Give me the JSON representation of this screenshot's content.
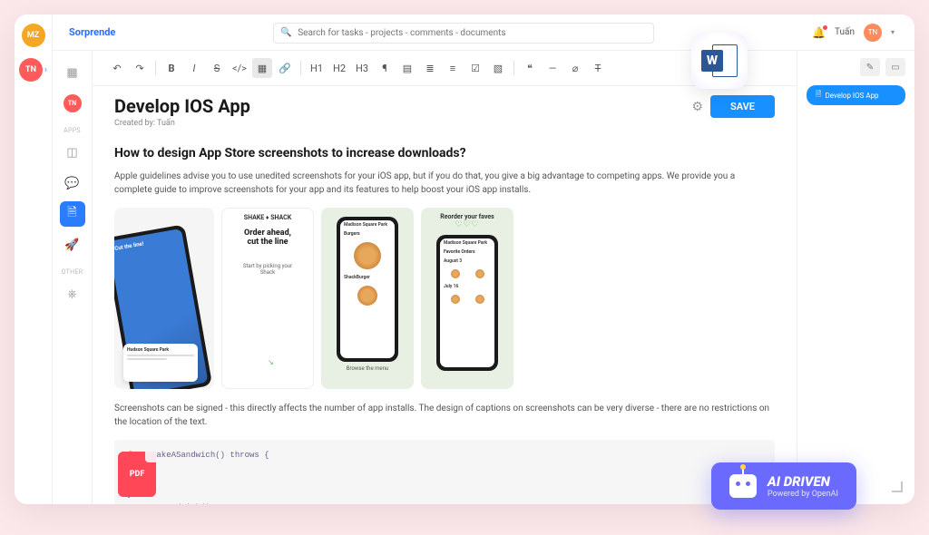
{
  "brand": "Sorprende",
  "search": {
    "placeholder": "Search for tasks - projects - comments - documents"
  },
  "user": {
    "name": "Tuấn",
    "initials": "TN"
  },
  "avatars": {
    "top": "MZ",
    "bottom": "TN"
  },
  "nav": {
    "group1": "APPS",
    "group2": "OTHER"
  },
  "toolbar": {
    "h1": "H1",
    "h2": "H2",
    "h3": "H3"
  },
  "doc": {
    "title": "Develop IOS App",
    "created_by_label": "Created by: Tuấn",
    "save": "SAVE",
    "heading": "How to design App Store screenshots to increase downloads?",
    "para1": "Apple guidelines advise you to use unedited screenshots for your iOS app, but if you do that, you give a big advantage to competing apps. We provide you a complete guide to improve screenshots for your app and its features to help boost your iOS app installs.",
    "para2": "Screenshots can be signed - this directly affects the number of app installs. The design of captions on screenshots can be very diverse - there are no restrictions on the location of the text.",
    "code": "func makeASandwich() throws {\n\n\n}\n        andwich()"
  },
  "shots": {
    "s1_label": "Cut the line!",
    "s1_card_title": "Hudson Square Park",
    "s2_brand": "SHAKE ♦ SHACK",
    "s2_head1": "Order ahead,",
    "s2_head2": "cut the line",
    "s2_sub": "Start by picking your Shack",
    "s3_top": "Madison Square Park",
    "s3_cat": "Burgers",
    "s3_item": "ShackBurger",
    "s3_bottom": "Browse the menu",
    "s4_title": "Reorder your faves",
    "s4_top": "Madison Square Park",
    "s4_sec": "Favorite Orders",
    "s4_d1": "August 3",
    "s4_d2": "July 16"
  },
  "rail": {
    "chip": "Develop IOS App"
  },
  "ai": {
    "title": "AI DRIVEN",
    "sub": "Powered by OpenAI"
  },
  "pdf": "PDF",
  "word": "W"
}
